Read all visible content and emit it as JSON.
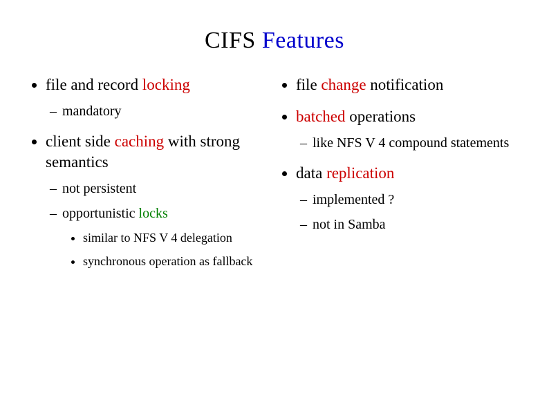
{
  "title": {
    "part1": "CIFS ",
    "part2": "Features"
  },
  "left": {
    "item1": {
      "t1": "file and record ",
      "t2": "locking",
      "sub1": "mandatory"
    },
    "item2": {
      "t1": "client side ",
      "t2": "caching",
      "t3": " with strong semantics",
      "sub1": "not persistent",
      "sub2": {
        "t1": "opportunistic ",
        "t2": "locks",
        "s1": "similar to NFS V 4 delegation",
        "s2": "synchronous operation as fallback"
      }
    }
  },
  "right": {
    "item1": {
      "t1": "file ",
      "t2": "change",
      "t3": " notification"
    },
    "item2": {
      "t1": "batched",
      "t2": " operations",
      "sub1": "like NFS V 4 compound statements"
    },
    "item3": {
      "t1": "data ",
      "t2": "replication",
      "sub1": "implemented ?",
      "sub2": "not in Samba"
    }
  }
}
